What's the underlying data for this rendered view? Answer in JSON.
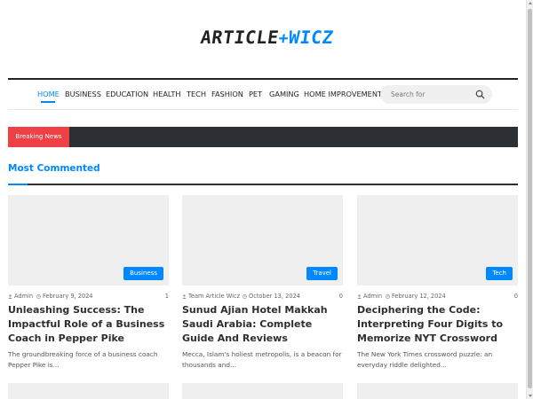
{
  "logo": {
    "part1": "ARTICLE",
    "plus": "+",
    "part2": "WICZ"
  },
  "nav": {
    "items": [
      "HOME",
      "BUSINESS",
      "EDUCATION",
      "HEALTH",
      "TECH",
      "FASHION",
      "PET",
      "GAMING",
      "HOME IMPROVEMENT"
    ],
    "active": "HOME",
    "search_placeholder": "Search for"
  },
  "breaking": {
    "label": "Breaking News"
  },
  "section": {
    "title": "Most Commented"
  },
  "posts": [
    {
      "category": "Business",
      "author": "Admin",
      "date": "February 9, 2024",
      "comments": "1",
      "title": "Unleashing Success: The Impactful Role of a Business Coach in Pepper Pike",
      "excerpt": "The groundbreaking force of a business coach Pepper Pike is..."
    },
    {
      "category": "Travel",
      "author": "Team Article Wicz",
      "date": "October 13, 2024",
      "comments": "0",
      "title": "Sunud Ajian Hotel Makkah Saudi Arabia: Complete Guide And Reviews",
      "excerpt": "Mecca, Islam's holiest metropolis, is a beacon for thousands and..."
    },
    {
      "category": "Tech",
      "author": "Admin",
      "date": "February 12, 2024",
      "comments": "0",
      "title": "Deciphering the Code: Interpreting Four Digits to Memorize NYT Crossword",
      "excerpt": "The New York Times crossword puzzle: an everyday riddle delighted..."
    }
  ],
  "colors": {
    "accent": "#0088ff",
    "breaking": "#ef4046",
    "dark": "#2c2f34"
  }
}
